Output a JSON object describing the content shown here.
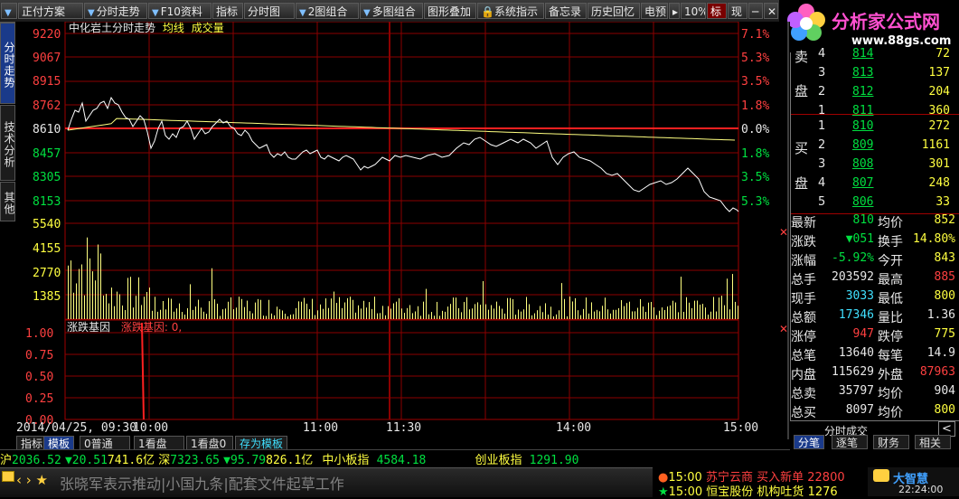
{
  "toolbar": {
    "items": [
      "正付方案",
      "分时走势",
      "F10资料",
      "指标",
      "分时图",
      "2图组合",
      "多图组合",
      "图形叠加",
      "系统指示",
      "备忘录",
      "历史回忆",
      "电预",
      "10%",
      "标",
      "现"
    ]
  },
  "logo": {
    "title": "分析家公式网",
    "url": "www.88gs.com"
  },
  "left_tabs": [
    "分时走势",
    "技术分析",
    "其他"
  ],
  "chart": {
    "title": "中化岩土分时走势",
    "avg_label": "均线",
    "vol_label": "成交量",
    "price_labels": [
      "9220",
      "9067",
      "8915",
      "8762",
      "8610",
      "8457",
      "8305",
      "8153"
    ],
    "pct_labels": [
      "7.1%",
      "5.3%",
      "3.5%",
      "1.8%",
      "0.0%",
      "1.8%",
      "3.5%",
      "5.3%"
    ],
    "vol_labels": [
      "5540",
      "4155",
      "2770",
      "1385"
    ],
    "sub_title": "涨跌基因",
    "sub_title2": "涨跌基因: 0,",
    "sub_labels": [
      "1.00",
      "0.75",
      "0.50",
      "0.25",
      "0.00"
    ],
    "time_labels": [
      "2014/04/25, 09:30",
      "10:00",
      "11:00",
      "11:30",
      "14:00",
      "15:00"
    ],
    "colors": {
      "price_line": "#ffffff",
      "avg_line": "#ffff80",
      "grid": "#8b0000",
      "volume": "#ffff80",
      "zero": "#ff2020"
    }
  },
  "orderbook": {
    "sell_label": [
      "卖",
      "盘"
    ],
    "buy_label": [
      "买",
      "盘"
    ],
    "sell": [
      {
        "n": "4",
        "price": "814",
        "vol": "72"
      },
      {
        "n": "3",
        "price": "813",
        "vol": "137"
      },
      {
        "n": "2",
        "price": "812",
        "vol": "204"
      },
      {
        "n": "1",
        "price": "811",
        "vol": "360"
      }
    ],
    "buy": [
      {
        "n": "1",
        "price": "810",
        "vol": "272"
      },
      {
        "n": "2",
        "price": "809",
        "vol": "1161"
      },
      {
        "n": "3",
        "price": "808",
        "vol": "301"
      },
      {
        "n": "4",
        "price": "807",
        "vol": "248"
      },
      {
        "n": "5",
        "price": "806",
        "vol": "33"
      }
    ]
  },
  "stats": [
    {
      "l1": "最新",
      "v1": "810",
      "l2": "均价",
      "v2": "852"
    },
    {
      "l1": "涨跌",
      "v1": "▼051",
      "l2": "换手",
      "v2": "14.80%"
    },
    {
      "l1": "涨幅",
      "v1": "-5.92%",
      "l2": "今开",
      "v2": "843"
    },
    {
      "l1": "总手",
      "v1": "203592",
      "l2": "最高",
      "v2": "885"
    },
    {
      "l1": "现手",
      "v1": "3033",
      "l2": "最低",
      "v2": "800"
    },
    {
      "l1": "总额",
      "v1": "17346",
      "l2": "量比",
      "v2": "1.36"
    },
    {
      "l1": "涨停",
      "v1": "947",
      "l2": "跌停",
      "v2": "775"
    },
    {
      "l1": "总笔",
      "v1": "13640",
      "l2": "每笔",
      "v2": "14.9"
    },
    {
      "l1": "内盘",
      "v1": "115629",
      "l2": "外盘",
      "v2": "87963"
    },
    {
      "l1": "总卖",
      "v1": "35797",
      "l2": "均价",
      "v2": "904"
    },
    {
      "l1": "总买",
      "v1": "8097",
      "l2": "均价",
      "v2": "800"
    }
  ],
  "right_bottom": {
    "deal_label": "分时成交",
    "tabs": [
      "分笔",
      "逐笔",
      "财务",
      "相关"
    ]
  },
  "bottom_tabs": [
    "指标",
    "模板",
    "0普通",
    "1看盘",
    "1看盘0",
    "存为模板"
  ],
  "market": {
    "sh_label": "沪",
    "sh_value": "2036.52",
    "sh_change": "▼20.51",
    "sh_amount": "741.6亿",
    "sz_label": "深",
    "sz_value": "7323.65",
    "sz_change": "▼95.79",
    "sz_amount": "826.1亿",
    "sme_label": "中小板指",
    "sme_value": "4584.18",
    "gem_label": "创业板指",
    "gem_value": "1291.90"
  },
  "ticker": {
    "text": "张晓军表示推动|小国九条|配套文件起草工作"
  },
  "news": [
    {
      "time": "15:00",
      "stock": "苏宁云商",
      "action": "买入新单",
      "value": "22800"
    },
    {
      "time": "15:00",
      "stock": "恒宝股份",
      "action": "机构吐货",
      "value": "1276"
    }
  ],
  "brand": "大智慧",
  "clock": "22:24:00"
}
